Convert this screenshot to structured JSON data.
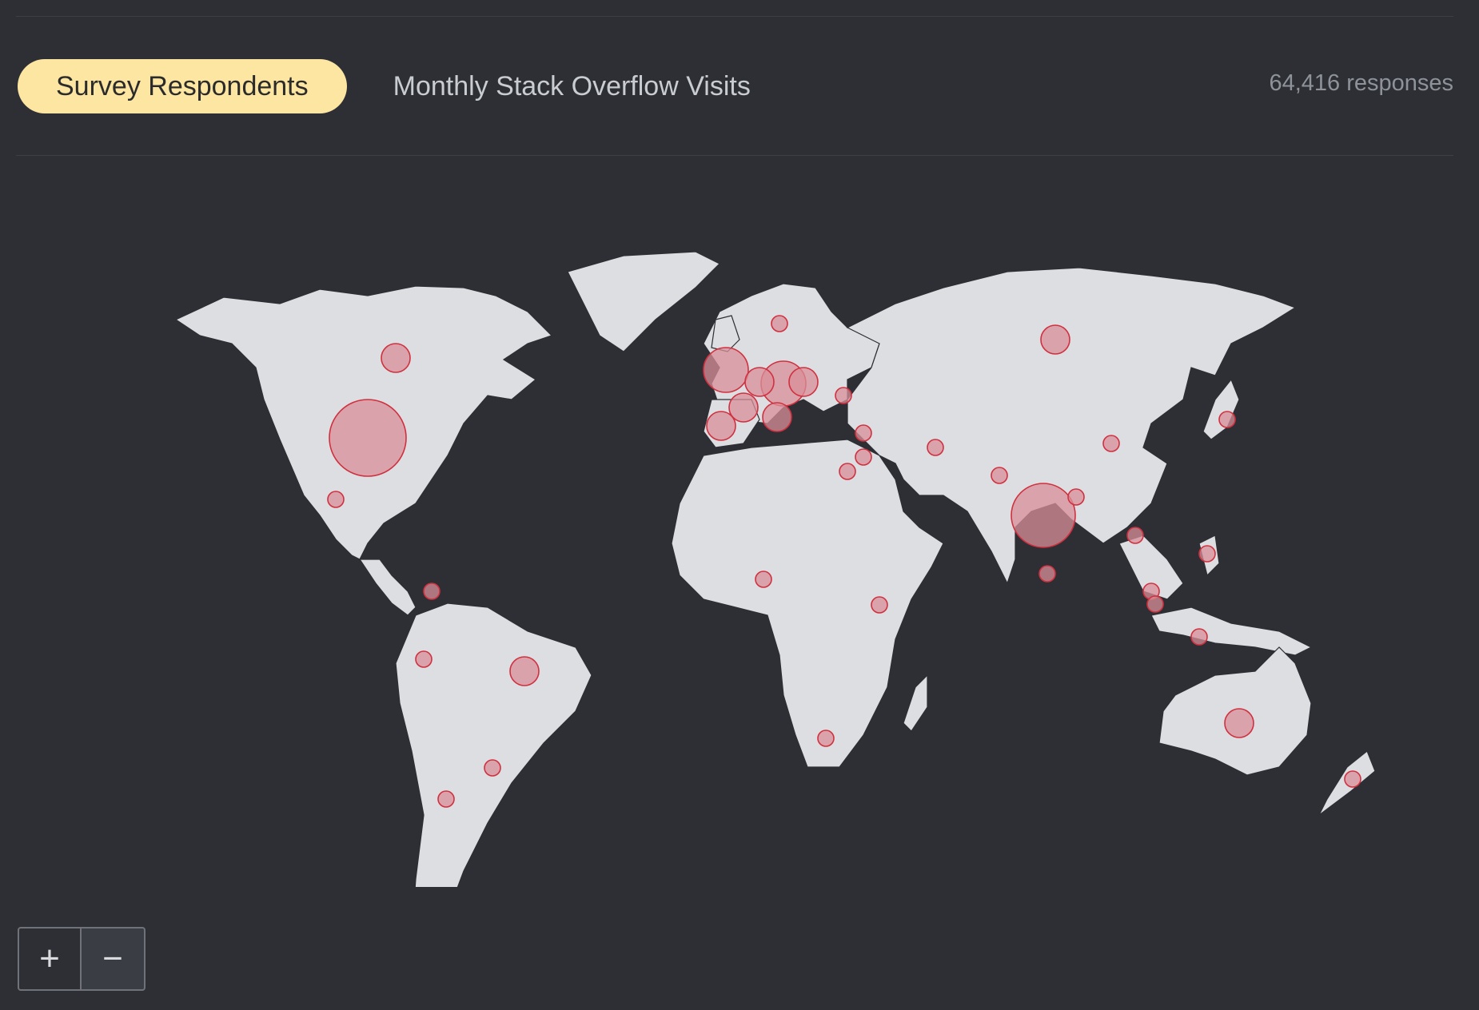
{
  "tabs": [
    {
      "label": "Survey Respondents",
      "active": true
    },
    {
      "label": "Monthly Stack Overflow Visits",
      "active": false
    }
  ],
  "response_count": "64,416 responses",
  "zoom": {
    "in_label": "+",
    "out_label": "−"
  },
  "colors": {
    "background": "#2d2f34",
    "land": "#dcdee1",
    "borders": "#2d2f34",
    "bubble_fill": "#d98f98",
    "bubble_stroke": "#d0303f",
    "active_tab": "#fde6a1"
  },
  "map": {
    "projection": "equirectangular-like",
    "metric": "survey respondents by country",
    "bubbles": [
      {
        "region": "United States",
        "size": 5
      },
      {
        "region": "India",
        "size": 4
      },
      {
        "region": "United Kingdom",
        "size": 3
      },
      {
        "region": "Germany",
        "size": 3
      },
      {
        "region": "Canada",
        "size": 2
      },
      {
        "region": "France",
        "size": 2
      },
      {
        "region": "Russia",
        "size": 2
      },
      {
        "region": "Brazil",
        "size": 2
      },
      {
        "region": "Poland",
        "size": 2
      },
      {
        "region": "Spain",
        "size": 2
      },
      {
        "region": "Australia",
        "size": 2
      },
      {
        "region": "Netherlands",
        "size": 2
      },
      {
        "region": "Italy",
        "size": 2
      },
      {
        "region": "Turkey",
        "size": 1
      },
      {
        "region": "Mexico",
        "size": 1
      },
      {
        "region": "Ukraine",
        "size": 1
      },
      {
        "region": "Sweden",
        "size": 1
      },
      {
        "region": "Pakistan",
        "size": 1
      },
      {
        "region": "Nigeria",
        "size": 1
      },
      {
        "region": "Egypt",
        "size": 1
      },
      {
        "region": "Israel",
        "size": 1
      },
      {
        "region": "Iran",
        "size": 1
      },
      {
        "region": "South Africa",
        "size": 1
      },
      {
        "region": "Indonesia",
        "size": 1
      },
      {
        "region": "Philippines",
        "size": 1
      },
      {
        "region": "Bangladesh",
        "size": 1
      },
      {
        "region": "Argentina",
        "size": 1
      },
      {
        "region": "Colombia",
        "size": 1
      },
      {
        "region": "Japan",
        "size": 1
      },
      {
        "region": "China",
        "size": 1
      },
      {
        "region": "Kenya",
        "size": 1
      },
      {
        "region": "New Zealand",
        "size": 1
      },
      {
        "region": "Sri Lanka",
        "size": 1
      },
      {
        "region": "Vietnam",
        "size": 1
      },
      {
        "region": "Malaysia",
        "size": 1
      },
      {
        "region": "Singapore",
        "size": 1
      },
      {
        "region": "Chile",
        "size": 1
      },
      {
        "region": "Peru",
        "size": 1
      }
    ]
  }
}
